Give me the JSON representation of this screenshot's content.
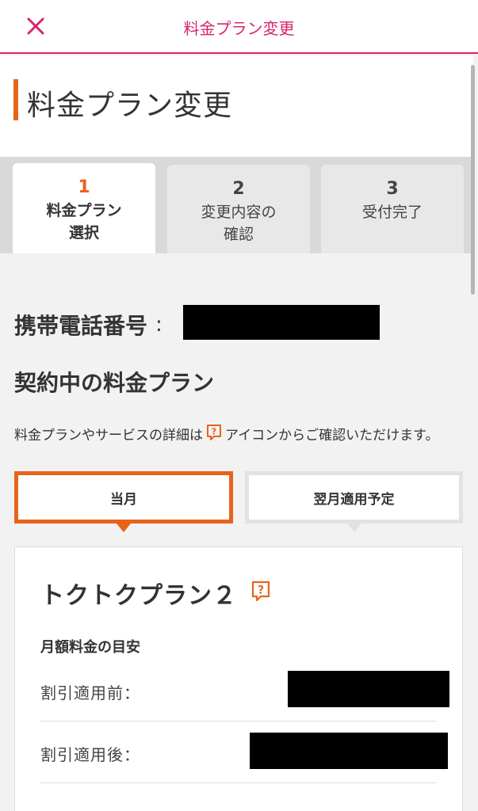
{
  "header": {
    "title": "料金プラン変更",
    "close_icon": "close-icon"
  },
  "page": {
    "title": "料金プラン変更"
  },
  "steps": [
    {
      "number": "1",
      "label": "料金プラン\n選択",
      "active": true
    },
    {
      "number": "2",
      "label": "変更内容の\n確認",
      "active": false
    },
    {
      "number": "3",
      "label": "受付完了",
      "active": false
    }
  ],
  "phone": {
    "label": "携帯電話番号",
    "colon": ":",
    "value_redacted": true
  },
  "current_plan": {
    "heading": "契約中の料金プラン",
    "note_before": "料金プランやサービスの詳細は",
    "note_after": "アイコンからご確認いただけます。"
  },
  "month_tabs": {
    "current": "当月",
    "next": "翌月適用予定"
  },
  "plan_card": {
    "plan_name": "トクトクプラン２",
    "fee_heading": "月額料金の目安",
    "fees": [
      {
        "label": "割引適用前：",
        "value_redacted": true
      },
      {
        "label": "割引適用後：",
        "value_redacted": true
      }
    ]
  },
  "colors": {
    "accent_pink": "#d6246e",
    "accent_orange": "#e8631a"
  }
}
